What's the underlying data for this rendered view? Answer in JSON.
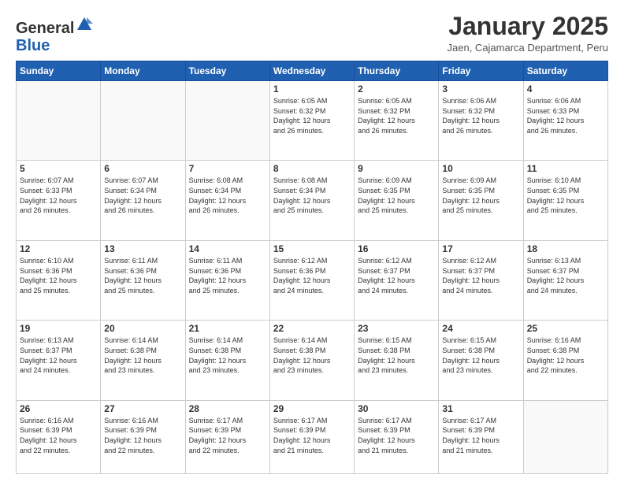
{
  "logo": {
    "general": "General",
    "blue": "Blue"
  },
  "header": {
    "month_title": "January 2025",
    "subtitle": "Jaen, Cajamarca Department, Peru"
  },
  "weekdays": [
    "Sunday",
    "Monday",
    "Tuesday",
    "Wednesday",
    "Thursday",
    "Friday",
    "Saturday"
  ],
  "weeks": [
    [
      {
        "day": "",
        "info": ""
      },
      {
        "day": "",
        "info": ""
      },
      {
        "day": "",
        "info": ""
      },
      {
        "day": "1",
        "info": "Sunrise: 6:05 AM\nSunset: 6:32 PM\nDaylight: 12 hours\nand 26 minutes."
      },
      {
        "day": "2",
        "info": "Sunrise: 6:05 AM\nSunset: 6:32 PM\nDaylight: 12 hours\nand 26 minutes."
      },
      {
        "day": "3",
        "info": "Sunrise: 6:06 AM\nSunset: 6:32 PM\nDaylight: 12 hours\nand 26 minutes."
      },
      {
        "day": "4",
        "info": "Sunrise: 6:06 AM\nSunset: 6:33 PM\nDaylight: 12 hours\nand 26 minutes."
      }
    ],
    [
      {
        "day": "5",
        "info": "Sunrise: 6:07 AM\nSunset: 6:33 PM\nDaylight: 12 hours\nand 26 minutes."
      },
      {
        "day": "6",
        "info": "Sunrise: 6:07 AM\nSunset: 6:34 PM\nDaylight: 12 hours\nand 26 minutes."
      },
      {
        "day": "7",
        "info": "Sunrise: 6:08 AM\nSunset: 6:34 PM\nDaylight: 12 hours\nand 26 minutes."
      },
      {
        "day": "8",
        "info": "Sunrise: 6:08 AM\nSunset: 6:34 PM\nDaylight: 12 hours\nand 25 minutes."
      },
      {
        "day": "9",
        "info": "Sunrise: 6:09 AM\nSunset: 6:35 PM\nDaylight: 12 hours\nand 25 minutes."
      },
      {
        "day": "10",
        "info": "Sunrise: 6:09 AM\nSunset: 6:35 PM\nDaylight: 12 hours\nand 25 minutes."
      },
      {
        "day": "11",
        "info": "Sunrise: 6:10 AM\nSunset: 6:35 PM\nDaylight: 12 hours\nand 25 minutes."
      }
    ],
    [
      {
        "day": "12",
        "info": "Sunrise: 6:10 AM\nSunset: 6:36 PM\nDaylight: 12 hours\nand 25 minutes."
      },
      {
        "day": "13",
        "info": "Sunrise: 6:11 AM\nSunset: 6:36 PM\nDaylight: 12 hours\nand 25 minutes."
      },
      {
        "day": "14",
        "info": "Sunrise: 6:11 AM\nSunset: 6:36 PM\nDaylight: 12 hours\nand 25 minutes."
      },
      {
        "day": "15",
        "info": "Sunrise: 6:12 AM\nSunset: 6:36 PM\nDaylight: 12 hours\nand 24 minutes."
      },
      {
        "day": "16",
        "info": "Sunrise: 6:12 AM\nSunset: 6:37 PM\nDaylight: 12 hours\nand 24 minutes."
      },
      {
        "day": "17",
        "info": "Sunrise: 6:12 AM\nSunset: 6:37 PM\nDaylight: 12 hours\nand 24 minutes."
      },
      {
        "day": "18",
        "info": "Sunrise: 6:13 AM\nSunset: 6:37 PM\nDaylight: 12 hours\nand 24 minutes."
      }
    ],
    [
      {
        "day": "19",
        "info": "Sunrise: 6:13 AM\nSunset: 6:37 PM\nDaylight: 12 hours\nand 24 minutes."
      },
      {
        "day": "20",
        "info": "Sunrise: 6:14 AM\nSunset: 6:38 PM\nDaylight: 12 hours\nand 23 minutes."
      },
      {
        "day": "21",
        "info": "Sunrise: 6:14 AM\nSunset: 6:38 PM\nDaylight: 12 hours\nand 23 minutes."
      },
      {
        "day": "22",
        "info": "Sunrise: 6:14 AM\nSunset: 6:38 PM\nDaylight: 12 hours\nand 23 minutes."
      },
      {
        "day": "23",
        "info": "Sunrise: 6:15 AM\nSunset: 6:38 PM\nDaylight: 12 hours\nand 23 minutes."
      },
      {
        "day": "24",
        "info": "Sunrise: 6:15 AM\nSunset: 6:38 PM\nDaylight: 12 hours\nand 23 minutes."
      },
      {
        "day": "25",
        "info": "Sunrise: 6:16 AM\nSunset: 6:38 PM\nDaylight: 12 hours\nand 22 minutes."
      }
    ],
    [
      {
        "day": "26",
        "info": "Sunrise: 6:16 AM\nSunset: 6:39 PM\nDaylight: 12 hours\nand 22 minutes."
      },
      {
        "day": "27",
        "info": "Sunrise: 6:16 AM\nSunset: 6:39 PM\nDaylight: 12 hours\nand 22 minutes."
      },
      {
        "day": "28",
        "info": "Sunrise: 6:17 AM\nSunset: 6:39 PM\nDaylight: 12 hours\nand 22 minutes."
      },
      {
        "day": "29",
        "info": "Sunrise: 6:17 AM\nSunset: 6:39 PM\nDaylight: 12 hours\nand 21 minutes."
      },
      {
        "day": "30",
        "info": "Sunrise: 6:17 AM\nSunset: 6:39 PM\nDaylight: 12 hours\nand 21 minutes."
      },
      {
        "day": "31",
        "info": "Sunrise: 6:17 AM\nSunset: 6:39 PM\nDaylight: 12 hours\nand 21 minutes."
      },
      {
        "day": "",
        "info": ""
      }
    ]
  ]
}
